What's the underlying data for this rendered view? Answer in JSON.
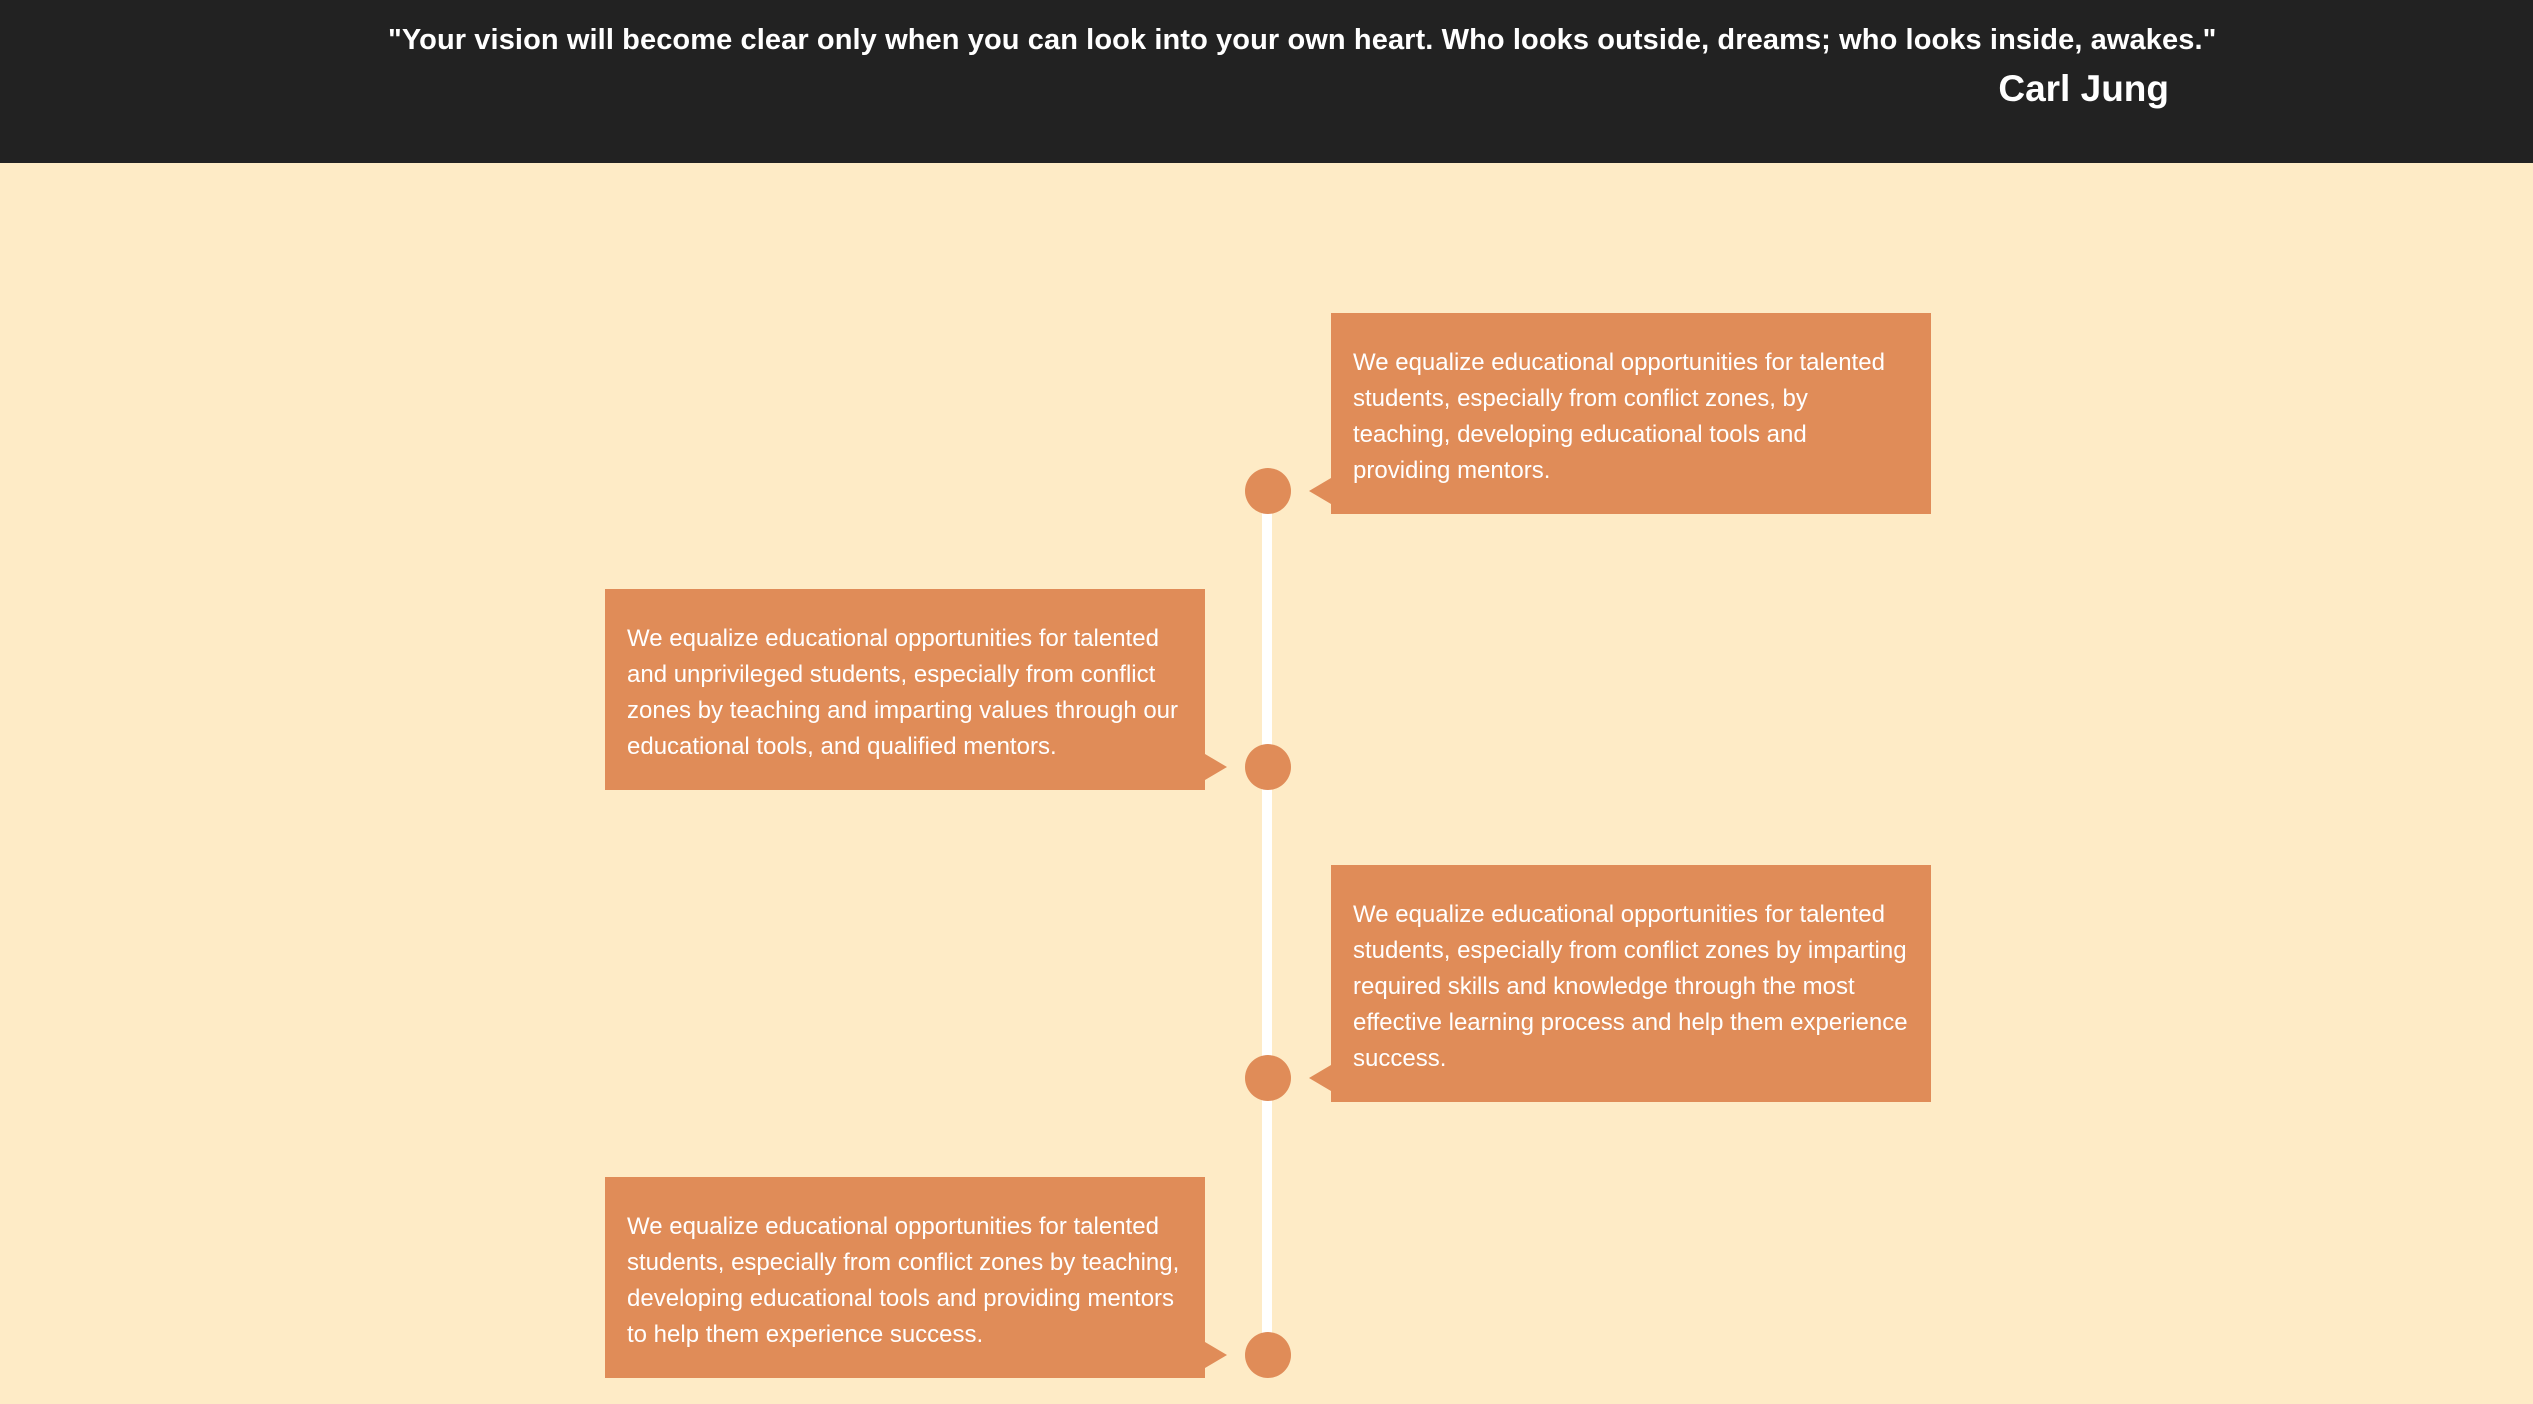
{
  "quote": {
    "text": "\"Your vision will become clear only when you can look into your own heart. Who looks outside, dreams; who looks inside, awakes.\"",
    "author": "Carl Jung"
  },
  "timeline": {
    "items": [
      {
        "side": "right",
        "text": "We equalize educational opportunities for talented students, especially from conflict zones, by teaching, developing educational tools and providing mentors."
      },
      {
        "side": "left",
        "text": "We equalize educational opportunities for talented and unprivileged students, especially from conflict zones by teaching and imparting values through our educational tools, and qualified mentors."
      },
      {
        "side": "right",
        "text": "We equalize educational opportunities for talented students, especially from conflict zones by imparting required skills and knowledge through the most effective learning process and help them experience success."
      },
      {
        "side": "left",
        "text": "We equalize educational opportunities for talented students, especially from conflict zones by teaching, developing educational tools and providing mentors to help them experience success."
      }
    ]
  },
  "colors": {
    "banner": "#222222",
    "background": "#feebc6",
    "accent": "#e08c58",
    "line": "#ffffff"
  }
}
